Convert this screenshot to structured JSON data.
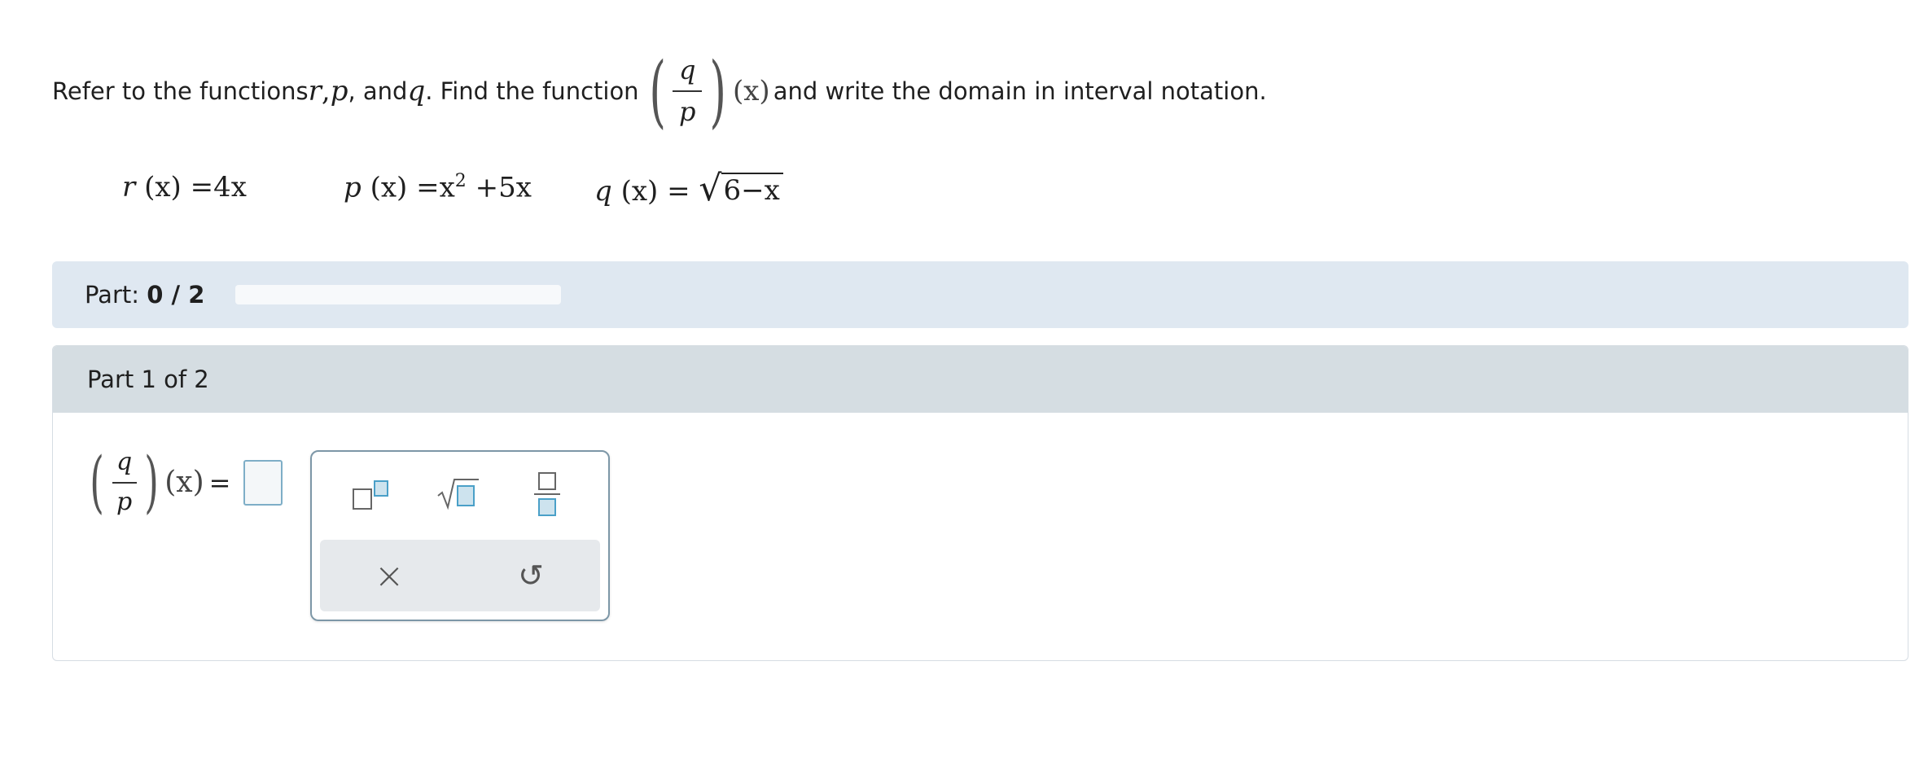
{
  "prompt": {
    "text_before": "Refer to the functions ",
    "var_r": "r",
    "comma1": ", ",
    "var_p": "p",
    "comma2": ", and ",
    "var_q": "q",
    "text_mid": ". Find the function ",
    "frac_num": "q",
    "frac_den": "p",
    "arg": "(x)",
    "text_after": " and write the domain in interval notation."
  },
  "definitions": {
    "r": {
      "name": "r",
      "lhs_arg": "(x)",
      "rhs": "=4x"
    },
    "p": {
      "name": "p",
      "lhs_arg": "(x)",
      "rhs_base": "=x",
      "rhs_exp": "2",
      "rhs_tail": "+5x"
    },
    "q": {
      "name": "q",
      "lhs_arg": "(x)",
      "rhs_eq": "=",
      "radicand": "6−x"
    }
  },
  "progress": {
    "label": "Part: ",
    "value": "0 / 2",
    "fraction_complete": 0
  },
  "part": {
    "header": "Part 1 of 2",
    "answer_num": "q",
    "answer_den": "p",
    "answer_arg": "(x)",
    "answer_eq": "="
  },
  "keypad": {
    "keys": [
      "superscript-key",
      "square-root-key",
      "fraction-key"
    ],
    "clear_symbol": "×",
    "undo_symbol": "↺"
  },
  "colors": {
    "progress_strip": "#dfe8f1",
    "part_header": "#d5dde2",
    "answer_border": "#7eaec7",
    "keypad_border": "#7d97a7",
    "key_accent": "#4aa0c8"
  }
}
